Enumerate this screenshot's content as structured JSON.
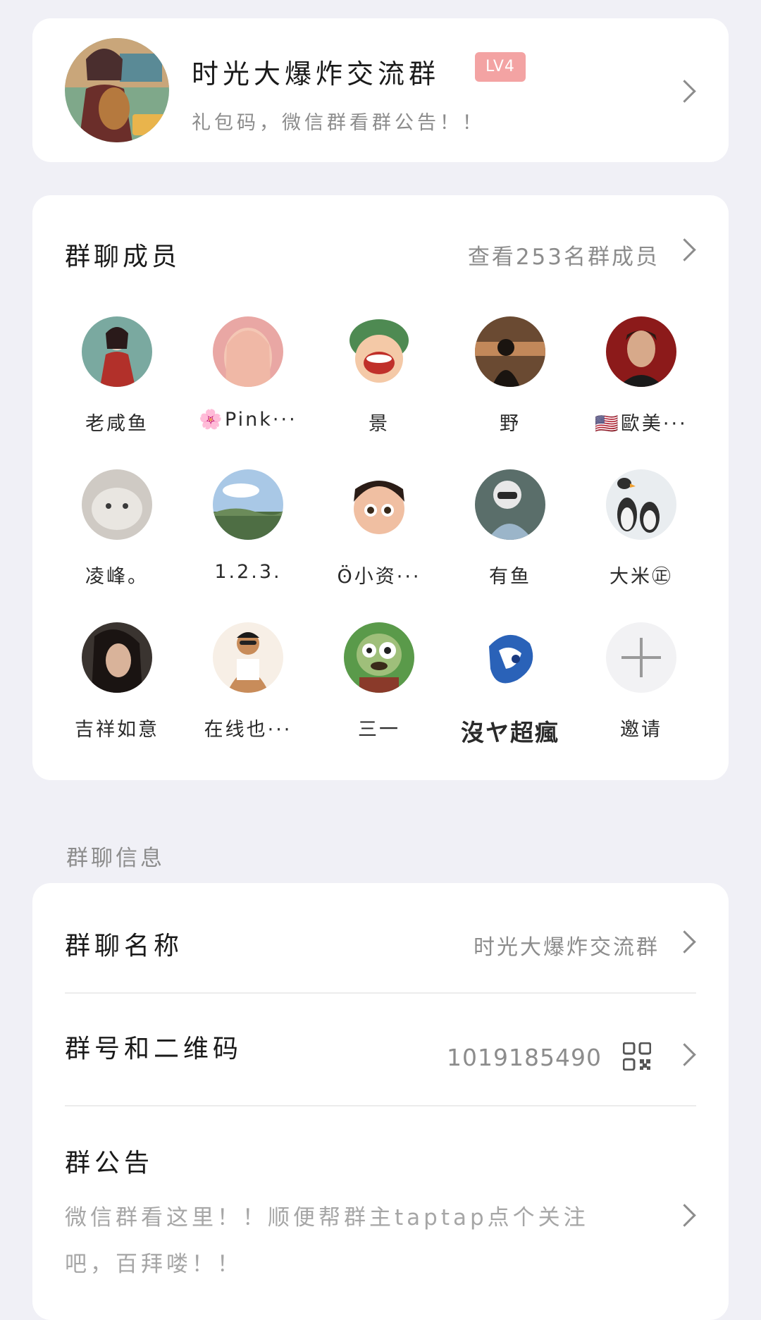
{
  "group": {
    "name": "时光大爆炸交流群",
    "level": "LV4",
    "description": "礼包码，微信群看群公告！！"
  },
  "members_section": {
    "title": "群聊成员",
    "view_all": "查看253名群成员",
    "members": [
      {
        "name": "老咸鱼"
      },
      {
        "name": "🌸Pink···"
      },
      {
        "name": "景"
      },
      {
        "name": "野"
      },
      {
        "name": "🇺🇸歐美···"
      },
      {
        "name": "凌峰。"
      },
      {
        "name": "1.2.3."
      },
      {
        "name": "ʘ̈小资···"
      },
      {
        "name": "有鱼"
      },
      {
        "name": "大米㊣"
      },
      {
        "name": "吉祥如意"
      },
      {
        "name": "在线也···"
      },
      {
        "name": "三一"
      },
      {
        "name": "沒ヤ超瘋"
      }
    ],
    "invite_label": "邀请"
  },
  "info_section": {
    "label": "群聊信息",
    "group_name_label": "群聊名称",
    "group_name_value": "时光大爆炸交流群",
    "group_number_label": "群号和二维码",
    "group_number_value": "1019185490",
    "notice_label": "群公告",
    "notice_text": "微信群看这里！！顺便帮群主taptap点个关注吧，百拜喽！！"
  },
  "colors": {
    "background": "#f0f0f6",
    "card": "#ffffff",
    "level_badge": "#f3a3a3",
    "secondary_text": "#8c8c8c"
  }
}
